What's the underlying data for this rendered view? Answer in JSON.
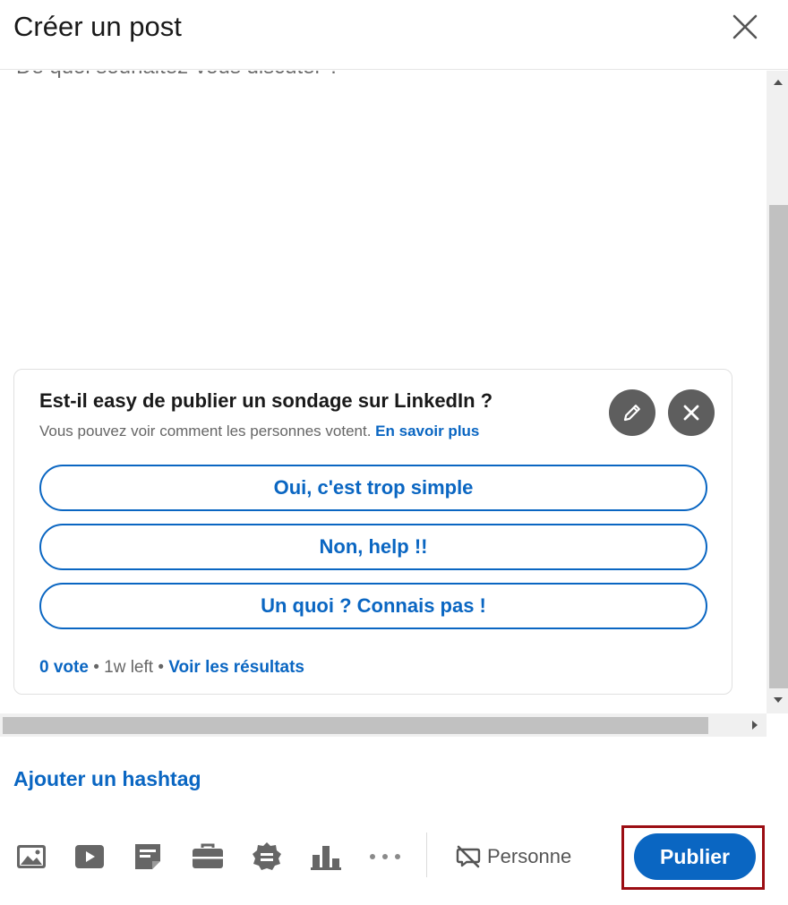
{
  "modal": {
    "title": "Créer un post",
    "close_icon": "close-icon"
  },
  "editor": {
    "placeholder": "De quoi souhaitez-vous discuter ?"
  },
  "poll": {
    "question": "Est-il easy de publier un sondage sur LinkedIn ?",
    "subtitle": "Vous pouvez voir comment les personnes votent.",
    "learn_more": "En savoir plus",
    "edit_icon": "pencil-icon",
    "remove_icon": "close-icon",
    "options": [
      "Oui, c'est trop simple",
      "Non, help !!",
      "Un quoi ? Connais pas !"
    ],
    "footer": {
      "votes": "0 vote",
      "separator1": " • ",
      "time_left": "1w left",
      "separator2": " • ",
      "results_link": "Voir les résultats"
    }
  },
  "hashtag_link": "Ajouter un hashtag",
  "toolbar": {
    "tools": [
      "photo-icon",
      "video-icon",
      "document-icon",
      "job-icon",
      "celebrate-icon",
      "poll-icon",
      "more-icon"
    ],
    "visibility_label": "Personne",
    "visibility_icon": "comment-off-icon",
    "publish_label": "Publier"
  },
  "colors": {
    "accent": "#0a66c2",
    "highlight_border": "#9b0d13",
    "icon_gray": "#666666",
    "round_button": "#5e5e5e"
  }
}
